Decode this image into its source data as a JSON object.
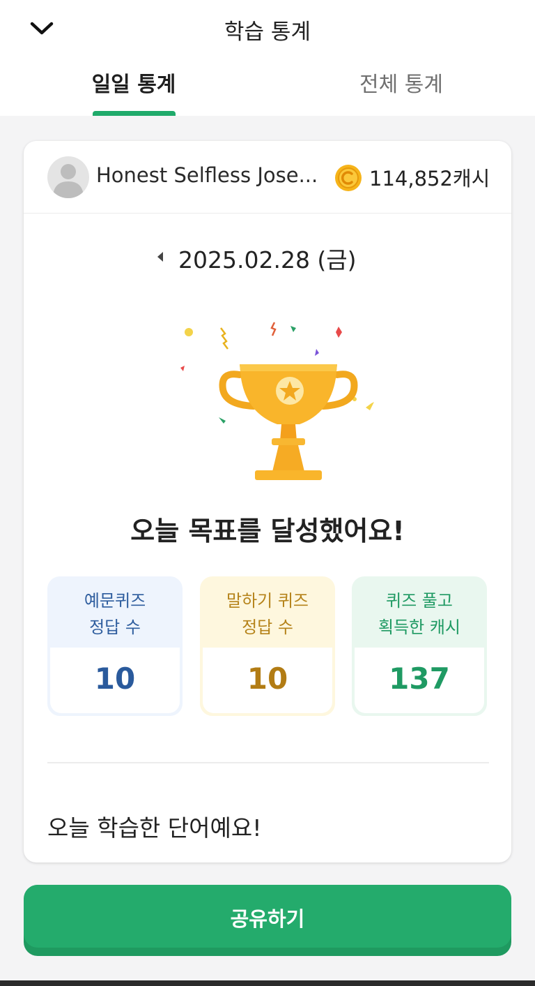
{
  "header": {
    "title": "학습 통계",
    "back_icon": "chevron-down-icon",
    "tabs": [
      {
        "label": "일일 통계",
        "active": true
      },
      {
        "label": "전체 통계",
        "active": false
      }
    ],
    "accent_color": "#1faa6a"
  },
  "user": {
    "name": "Honest Selfless Jose...",
    "cash": "114,852캐시",
    "coin_icon": "coin-icon"
  },
  "date": {
    "text": "2025.02.28 (금)",
    "prev_icon": "caret-left-icon"
  },
  "goal_message": "오늘 목표를 달성했어요!",
  "stats": [
    {
      "label_line1": "예문퀴즈",
      "label_line2": "정답 수",
      "value": "10",
      "color": "#2a5a9c"
    },
    {
      "label_line1": "말하기 퀴즈",
      "label_line2": "정답 수",
      "value": "10",
      "color": "#b27c14"
    },
    {
      "label_line1": "퀴즈 풀고",
      "label_line2": "획득한 캐시",
      "value": "137",
      "color": "#1f9a63"
    }
  ],
  "words_title": "오늘 학습한 단어예요!",
  "share_button": {
    "label": "공유하기",
    "color": "#24ab6c"
  }
}
